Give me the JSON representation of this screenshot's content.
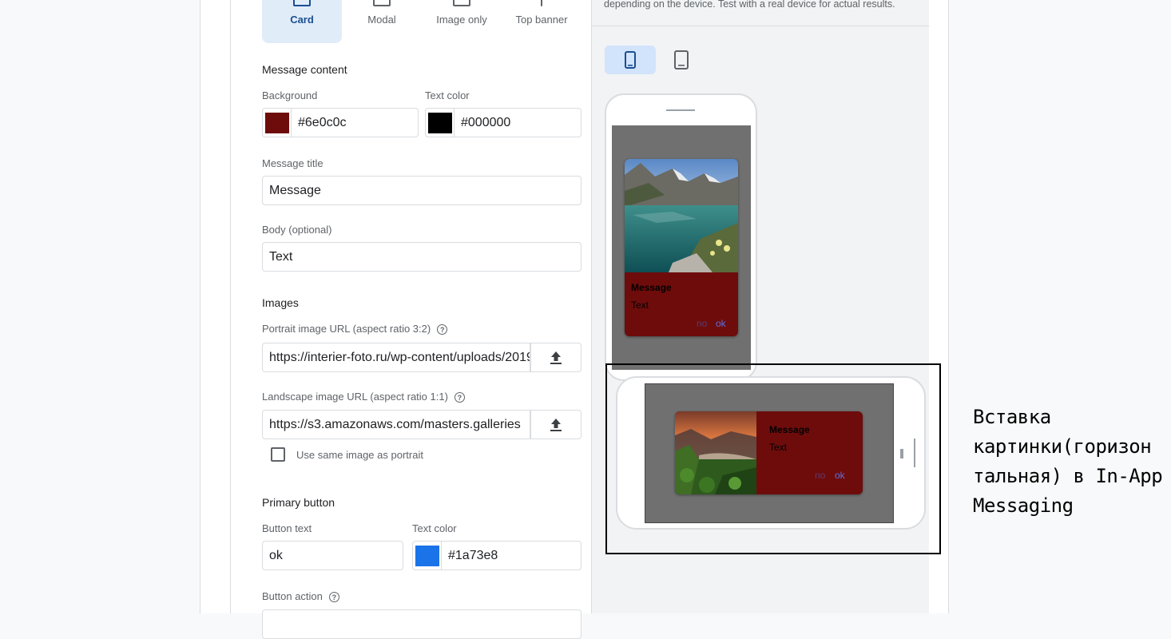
{
  "layout_tabs": [
    {
      "label": "Card",
      "active": true,
      "icon": "card-layout-icon"
    },
    {
      "label": "Modal",
      "active": false,
      "icon": "modal-layout-icon"
    },
    {
      "label": "Image only",
      "active": false,
      "icon": "image-layout-icon"
    },
    {
      "label": "Top banner",
      "active": false,
      "icon": "banner-layout-icon"
    }
  ],
  "message_content": {
    "heading": "Message content",
    "background_label": "Background",
    "background_value": "#6e0c0c",
    "text_color_label": "Text color",
    "text_color_value": "#000000",
    "title_label": "Message title",
    "title_value": "Message",
    "body_label": "Body (optional)",
    "body_value": "Text"
  },
  "images": {
    "heading": "Images",
    "portrait_label": "Portrait image URL (aspect ratio 3:2)",
    "portrait_value": "https://interier-foto.ru/wp-content/uploads/2019",
    "landscape_label": "Landscape image URL (aspect ratio 1:1)",
    "landscape_value": "https://s3.amazonaws.com/masters.galleries",
    "same_image_label": "Use same image as portrait",
    "same_image_checked": false
  },
  "primary_button": {
    "heading": "Primary button",
    "button_text_label": "Button text",
    "button_text_value": "ok",
    "text_color_label": "Text color",
    "text_color_value": "#1a73e8",
    "action_label": "Button action"
  },
  "preview": {
    "note": "depending on the device. Test with a real device for actual results.",
    "portrait_title": "Message",
    "portrait_body": "Text",
    "landscape_title": "Message",
    "landscape_body": "Text",
    "secondary_btn": "no",
    "primary_btn": "ok",
    "device_phone_icon": "phone-icon",
    "device_tablet_icon": "tablet-icon"
  },
  "annotation": "Вставка картинки(горизон тальная) в In-App Messaging"
}
